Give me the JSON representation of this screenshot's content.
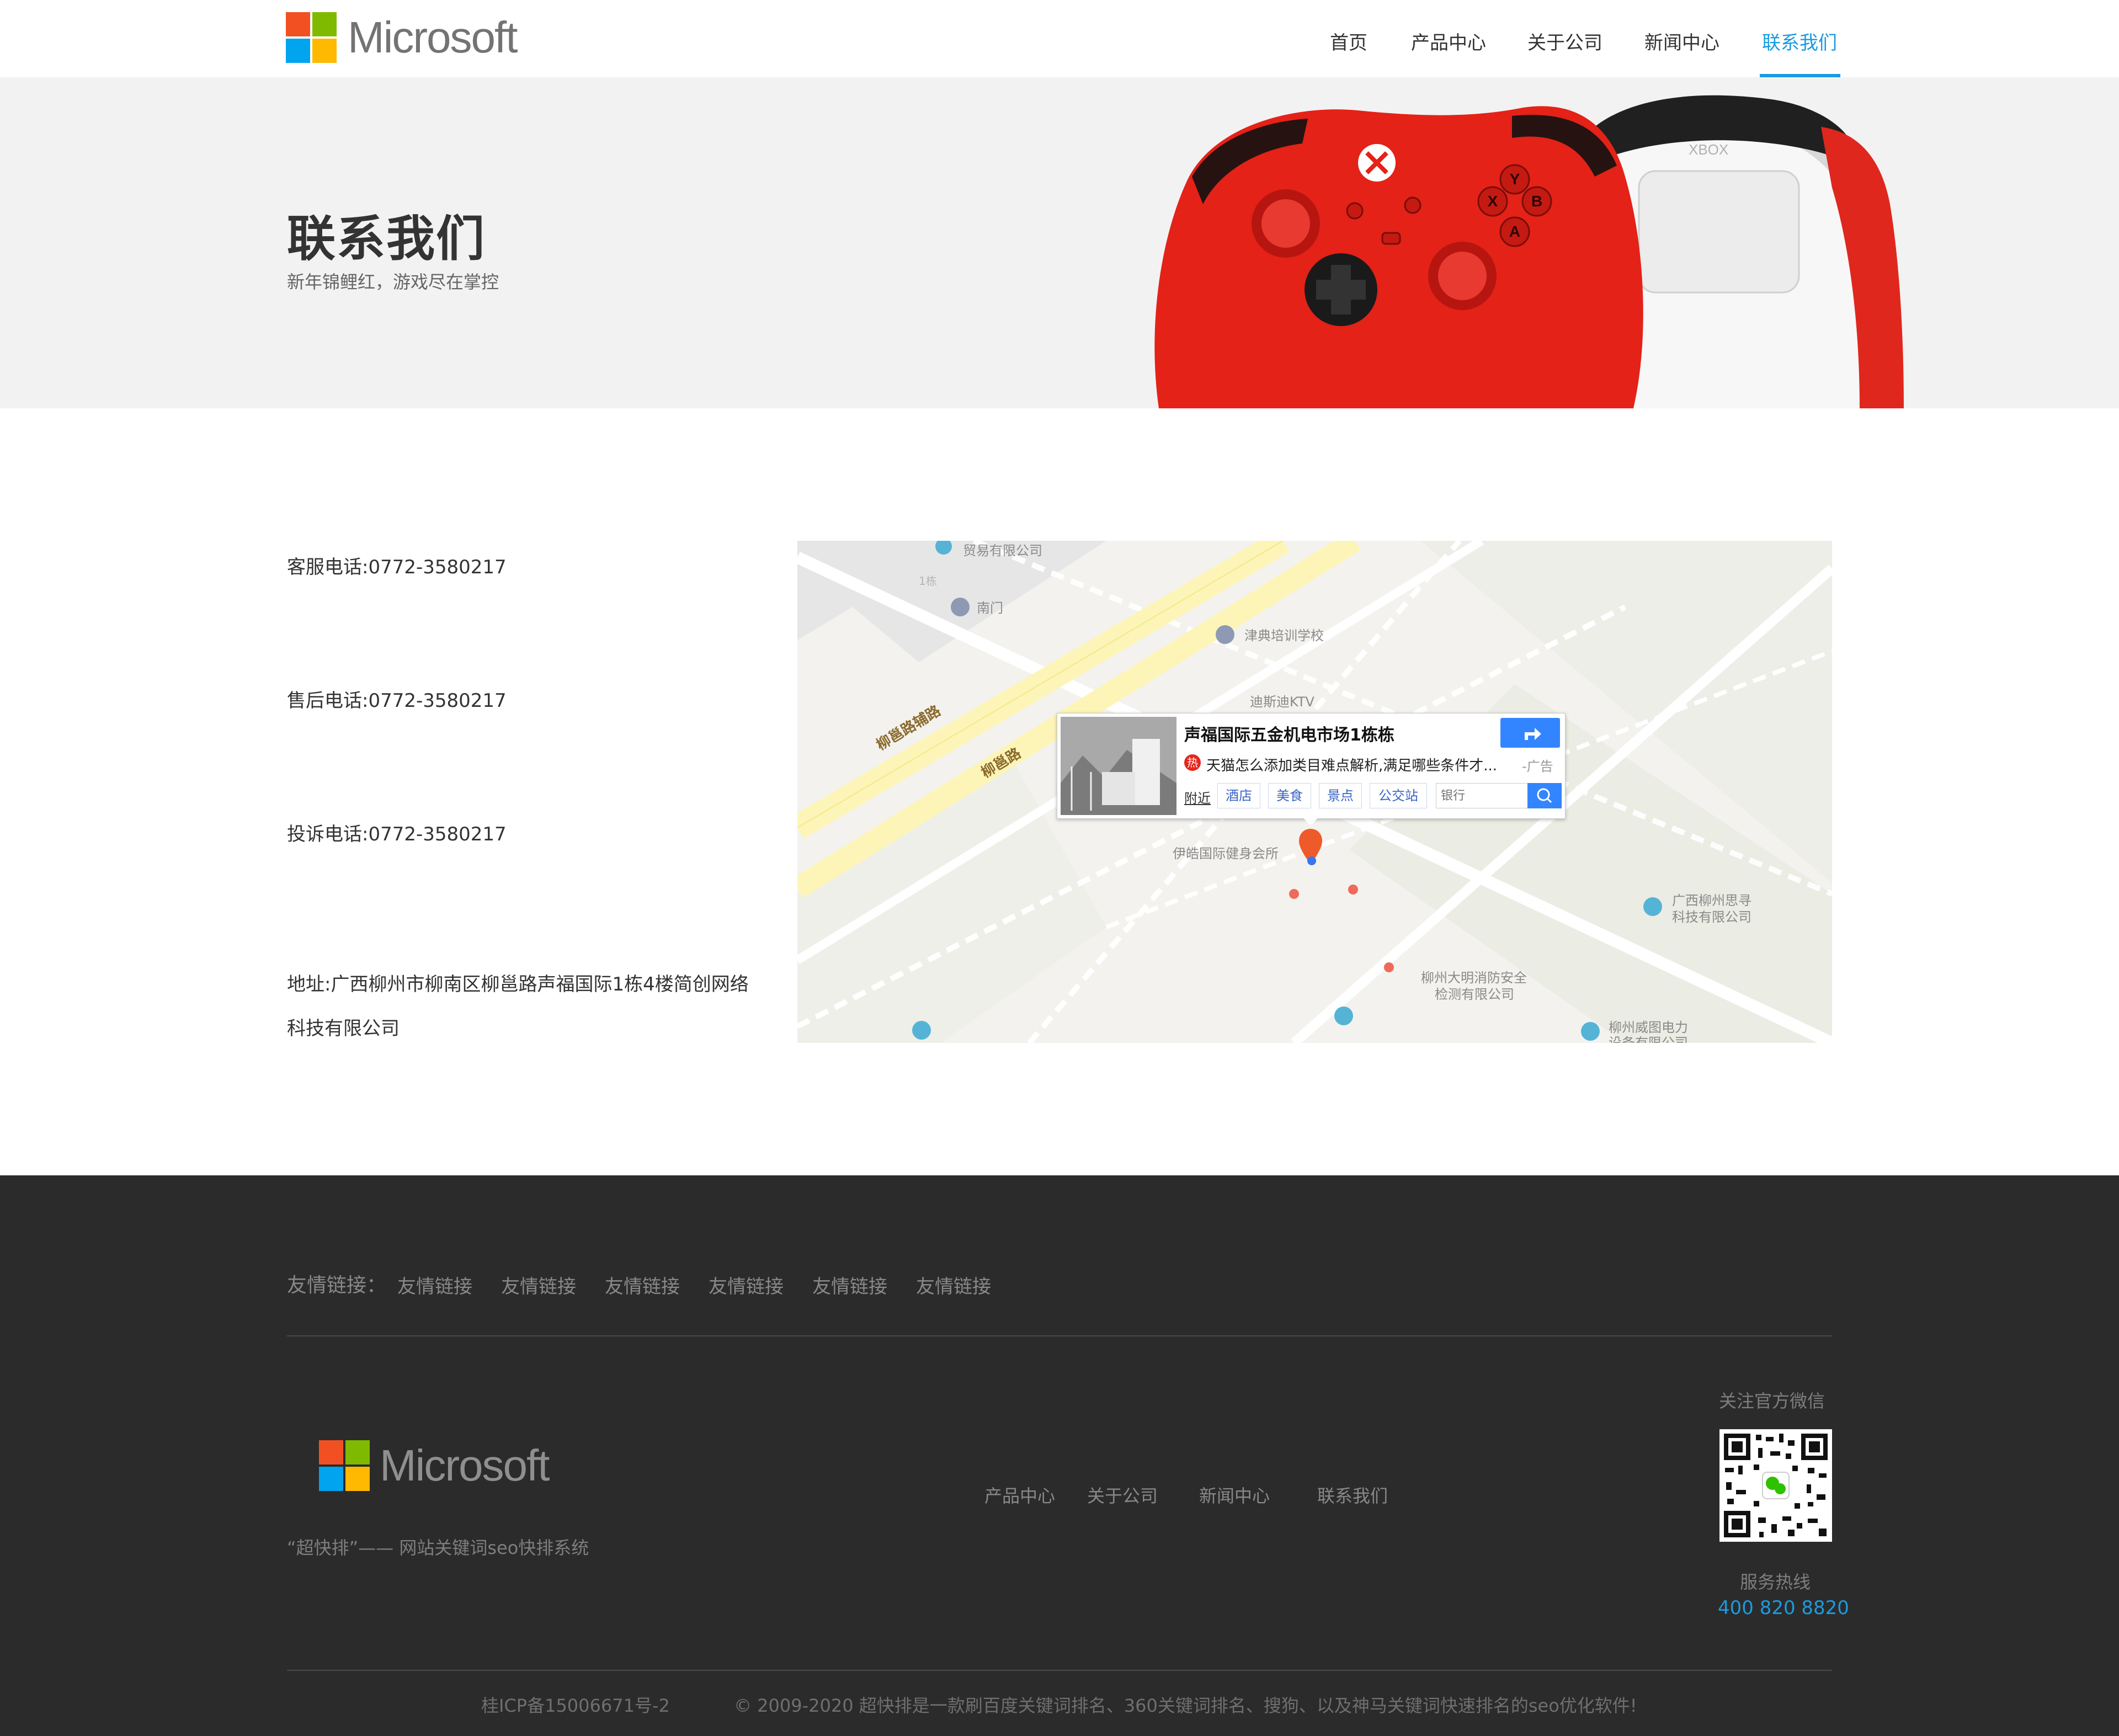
{
  "header": {
    "logo_text": "Microsoft",
    "nav": [
      "首页",
      "产品中心",
      "关于公司",
      "新闻中心",
      "联系我们"
    ],
    "active_nav": "联系我们"
  },
  "banner": {
    "title": "联系我们",
    "subtitle": "新年锦鲤红，游戏尽在掌控",
    "controller_front_buttons": [
      "Y",
      "B",
      "X",
      "A"
    ],
    "controller_back_label": "XBOX"
  },
  "contact": {
    "service_phone": "客服电话:0772-3580217",
    "aftersale_phone": "售后电话:0772-3580217",
    "complaint_phone": "投诉电话:0772-3580217",
    "address_line1": "地址:广西柳州市柳南区柳邕路声福国际1栋4楼简创网络",
    "address_line2": "科技有限公司"
  },
  "map": {
    "road_labels": [
      "柳邕路辅路",
      "柳邕路"
    ],
    "pois": [
      "贸易有限公司",
      "南门",
      "津典培训学校",
      "迪斯迪KTV",
      "伊皓国际健身会所",
      "广西柳州思寻",
      "科技有限公司",
      "柳州大明消防安全",
      "检测有限公司",
      "柳州威图电力",
      "设备有限公司",
      "1栋"
    ],
    "popup": {
      "title": "声福国际五金机电市场1栋栋",
      "hot_badge": "热",
      "ad_text": "天猫怎么添加类目难点解析,满足哪些条件才...",
      "ad_tag": "-广告",
      "nearby_label": "附近",
      "categories": [
        "酒店",
        "美食",
        "景点",
        "公交站"
      ],
      "search_placeholder": "银行"
    }
  },
  "footer": {
    "links_label": "友情链接：",
    "links": [
      "友情链接",
      "友情链接",
      "友情链接",
      "友情链接",
      "友情链接",
      "友情链接"
    ],
    "logo_text": "Microsoft",
    "slogan": "“超快排”—— 网站关键词seo快排系统",
    "nav": [
      "产品中心",
      "关于公司",
      "新闻中心",
      "联系我们"
    ],
    "wechat_label": "关注官方微信",
    "hotline_label": "服务热线",
    "hotline": "400 820 8820",
    "icp": "桂ICP备15006671号-2",
    "copyright": "© 2009-2020 超快排是一款刷百度关键词排名、360关键词排名、搜狗、以及神马关键词快速排名的seo优化软件!"
  },
  "colors": {
    "accent": "#1a9be0",
    "ms_red": "#f25022",
    "ms_green": "#7fba00",
    "ms_blue": "#00a4ef",
    "ms_yellow": "#ffb900",
    "footer_bg": "#2b2b2b",
    "banner_bg": "#f2f2f2",
    "map_bg": "#f3f2ee"
  },
  "icons": [
    "microsoft-logo-icon",
    "directions-icon",
    "search-icon",
    "map-pin-icon",
    "qr-code-icon",
    "wechat-icon"
  ]
}
